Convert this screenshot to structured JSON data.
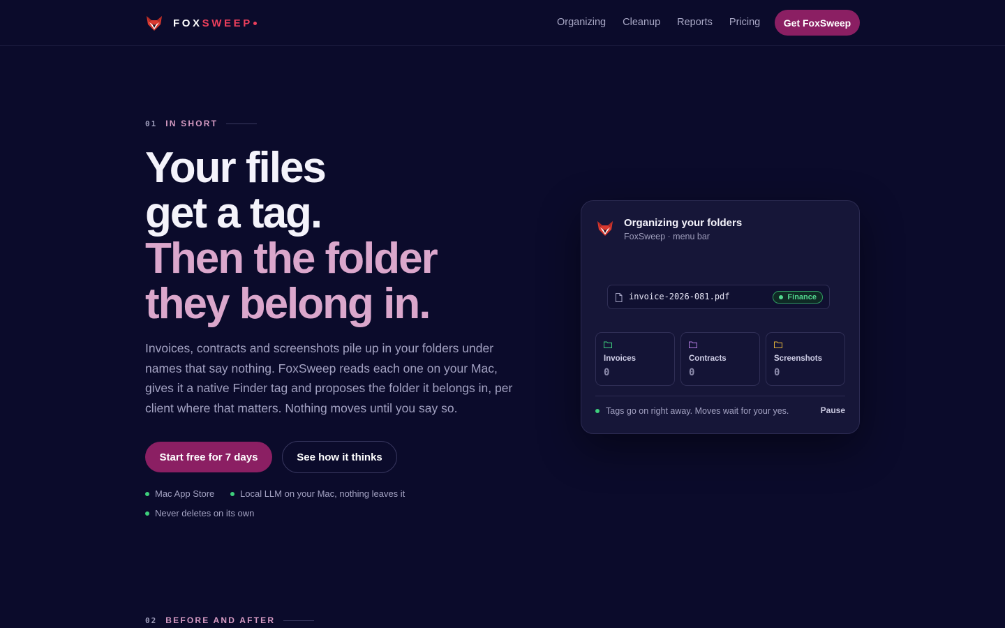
{
  "nav": {
    "brand": {
      "part1": "FOX",
      "part2": "SWEEP"
    },
    "links": [
      "Organizing",
      "Cleanup",
      "Reports",
      "Pricing"
    ],
    "cta": "Get FoxSweep"
  },
  "hero": {
    "eyebrow": {
      "number": "01",
      "label": "IN SHORT"
    },
    "headline": {
      "line1": "Your files",
      "line2": "get a tag.",
      "line3": "Then the folder",
      "line4": "they belong in."
    },
    "lede": "Invoices, contracts and screenshots pile up in your folders under names that say nothing. FoxSweep reads each one on your Mac, gives it a native Finder tag and proposes the folder it belongs in, per client where that matters. Nothing moves until you say so.",
    "primary_cta": "Start free for 7 days",
    "secondary_cta": "See how it thinks",
    "features": [
      "Mac App Store",
      "Local LLM on your Mac, nothing leaves it",
      "Never deletes on its own"
    ]
  },
  "card": {
    "title": "Organizing your folders",
    "subtitle": "FoxSweep · menu bar",
    "file": {
      "name": "invoice-2026-081.pdf",
      "tag": "Finance"
    },
    "folders": [
      {
        "name": "Invoices",
        "count": "0",
        "color": "#3ecf7c"
      },
      {
        "name": "Contracts",
        "count": "0",
        "color": "#b27be0"
      },
      {
        "name": "Screenshots",
        "count": "0",
        "color": "#e3b33a"
      }
    ],
    "status": "Tags go on right away. Moves wait for your yes.",
    "pause": "Pause"
  },
  "next_section": {
    "number": "02",
    "label": "BEFORE AND AFTER"
  },
  "colors": {
    "background": "#0b0b2b",
    "accent": "#8b1f63",
    "brand_red": "#ec3f5c",
    "headline_pink": "#dba7cc",
    "ok_green": "#3ecf7c"
  }
}
